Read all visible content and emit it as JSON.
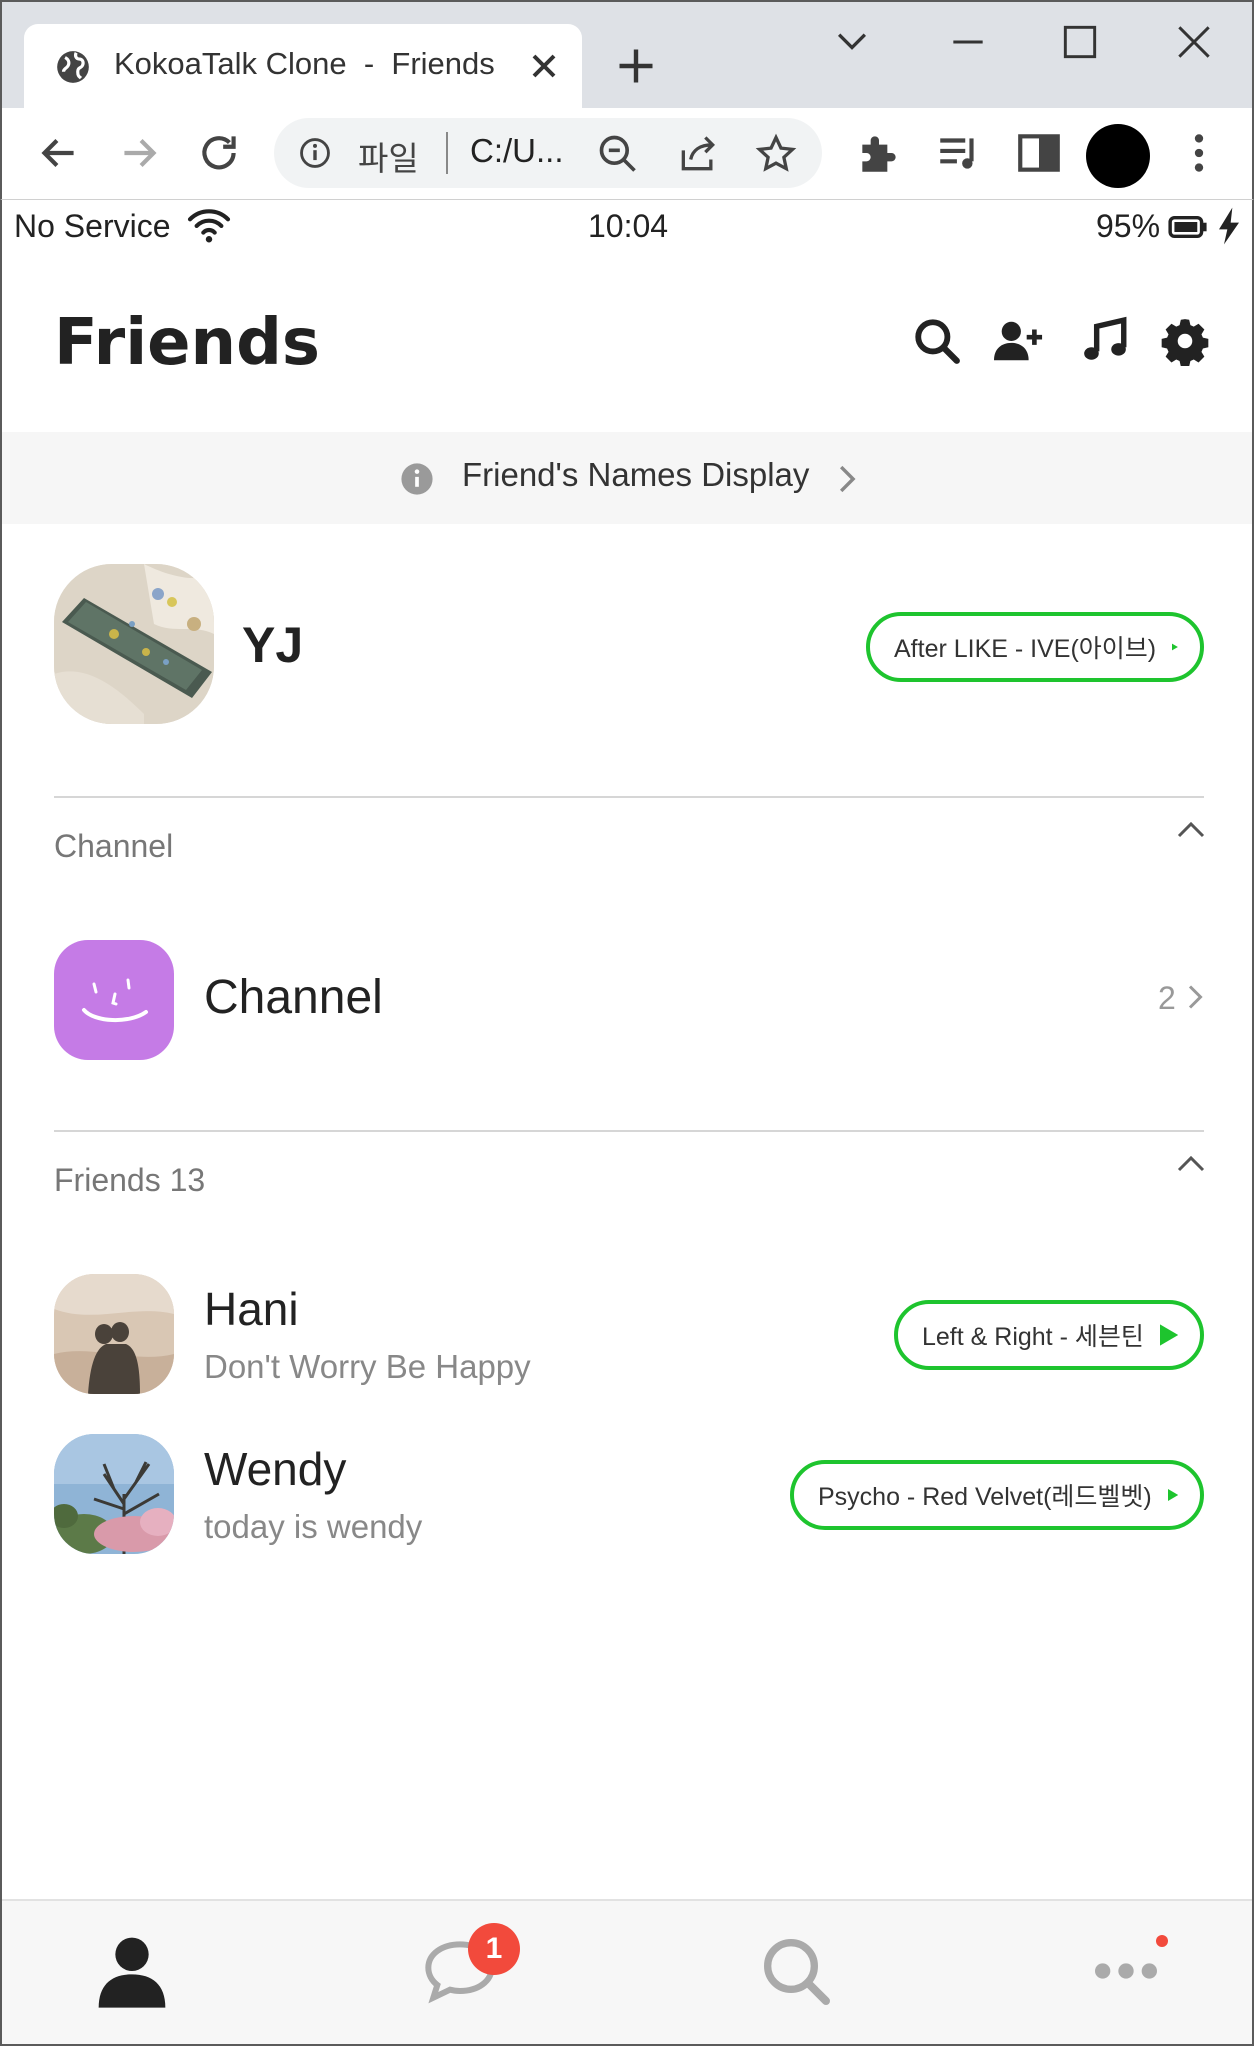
{
  "browser": {
    "tab_title": "KokoaTalk Clone  -  Friends",
    "url_scheme": "파일",
    "url": "C:/U..."
  },
  "status_bar": {
    "carrier": "No Service",
    "time": "10:04",
    "battery_percent": "95%"
  },
  "header": {
    "title": "Friends",
    "icons": [
      "search-icon",
      "add-friend-icon",
      "music-icon",
      "settings-icon"
    ]
  },
  "names_display_banner": {
    "label": "Friend's Names Display"
  },
  "my_profile": {
    "name": "YJ",
    "music": "After LIKE - IVE(아이브)"
  },
  "channel_section": {
    "label": "Channel",
    "item_name": "Channel",
    "count": "2"
  },
  "friends_section": {
    "label": "Friends 13",
    "friends": [
      {
        "name": "Hani",
        "status": "Don't Worry Be Happy",
        "music": "Left & Right - 세븐틴"
      },
      {
        "name": "Wendy",
        "status": "today is wendy",
        "music": "Psycho - Red Velvet(레드벨벳)"
      }
    ]
  },
  "bottom_nav": {
    "items": [
      "friends",
      "chats",
      "search",
      "more"
    ],
    "chat_badge": "1"
  },
  "colors": {
    "accent_green": "#1ec42e",
    "channel_purple": "#c57be6",
    "badge_red": "#f24a3c"
  }
}
